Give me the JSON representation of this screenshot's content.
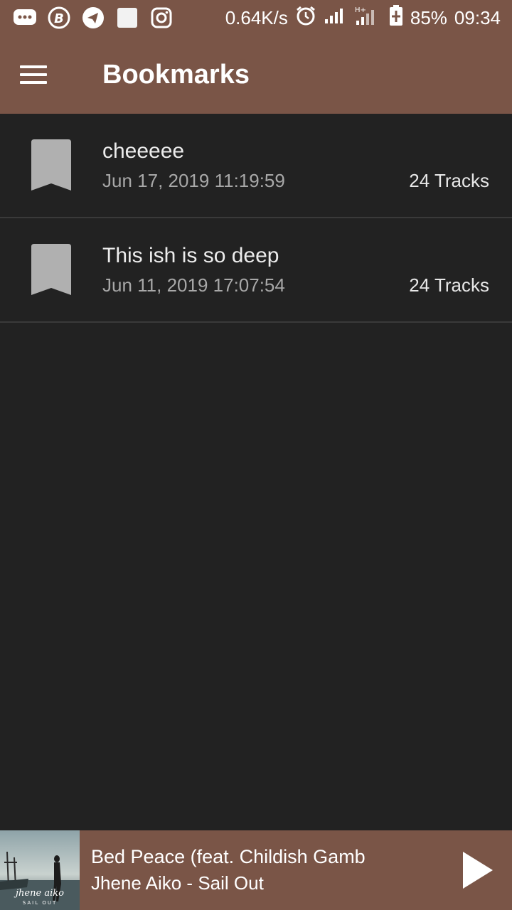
{
  "status_bar": {
    "net_speed": "0.64K/s",
    "battery": "85%",
    "time": "09:34",
    "icons_left": [
      "messages-icon",
      "bitcoin-icon",
      "telegram-icon",
      "blank-app-icon",
      "instagram-icon"
    ],
    "icons_right": [
      "alarm-icon",
      "signal-icon",
      "signal-h-plus-icon",
      "battery-charging-icon"
    ]
  },
  "app_bar": {
    "title": "Bookmarks",
    "menu_icon": "hamburger-menu-icon"
  },
  "bookmarks": [
    {
      "name": "cheeeee",
      "date": "Jun 17, 2019 11:19:59",
      "tracks": "24 Tracks"
    },
    {
      "name": "This ish is so deep",
      "date": "Jun 11, 2019 17:07:54",
      "tracks": "24 Tracks"
    }
  ],
  "now_playing": {
    "title": "Bed Peace (feat. Childish Gamb",
    "artist": "Jhene Aiko - Sail Out",
    "art_caption": "jhene aiko",
    "art_subcaption": "SAIL OUT",
    "play_icon": "play-icon"
  },
  "colors": {
    "accent": "#7a5547",
    "background": "#222222",
    "divider": "#3a3a3a",
    "bookmark_icon": "#b0b0b0"
  }
}
